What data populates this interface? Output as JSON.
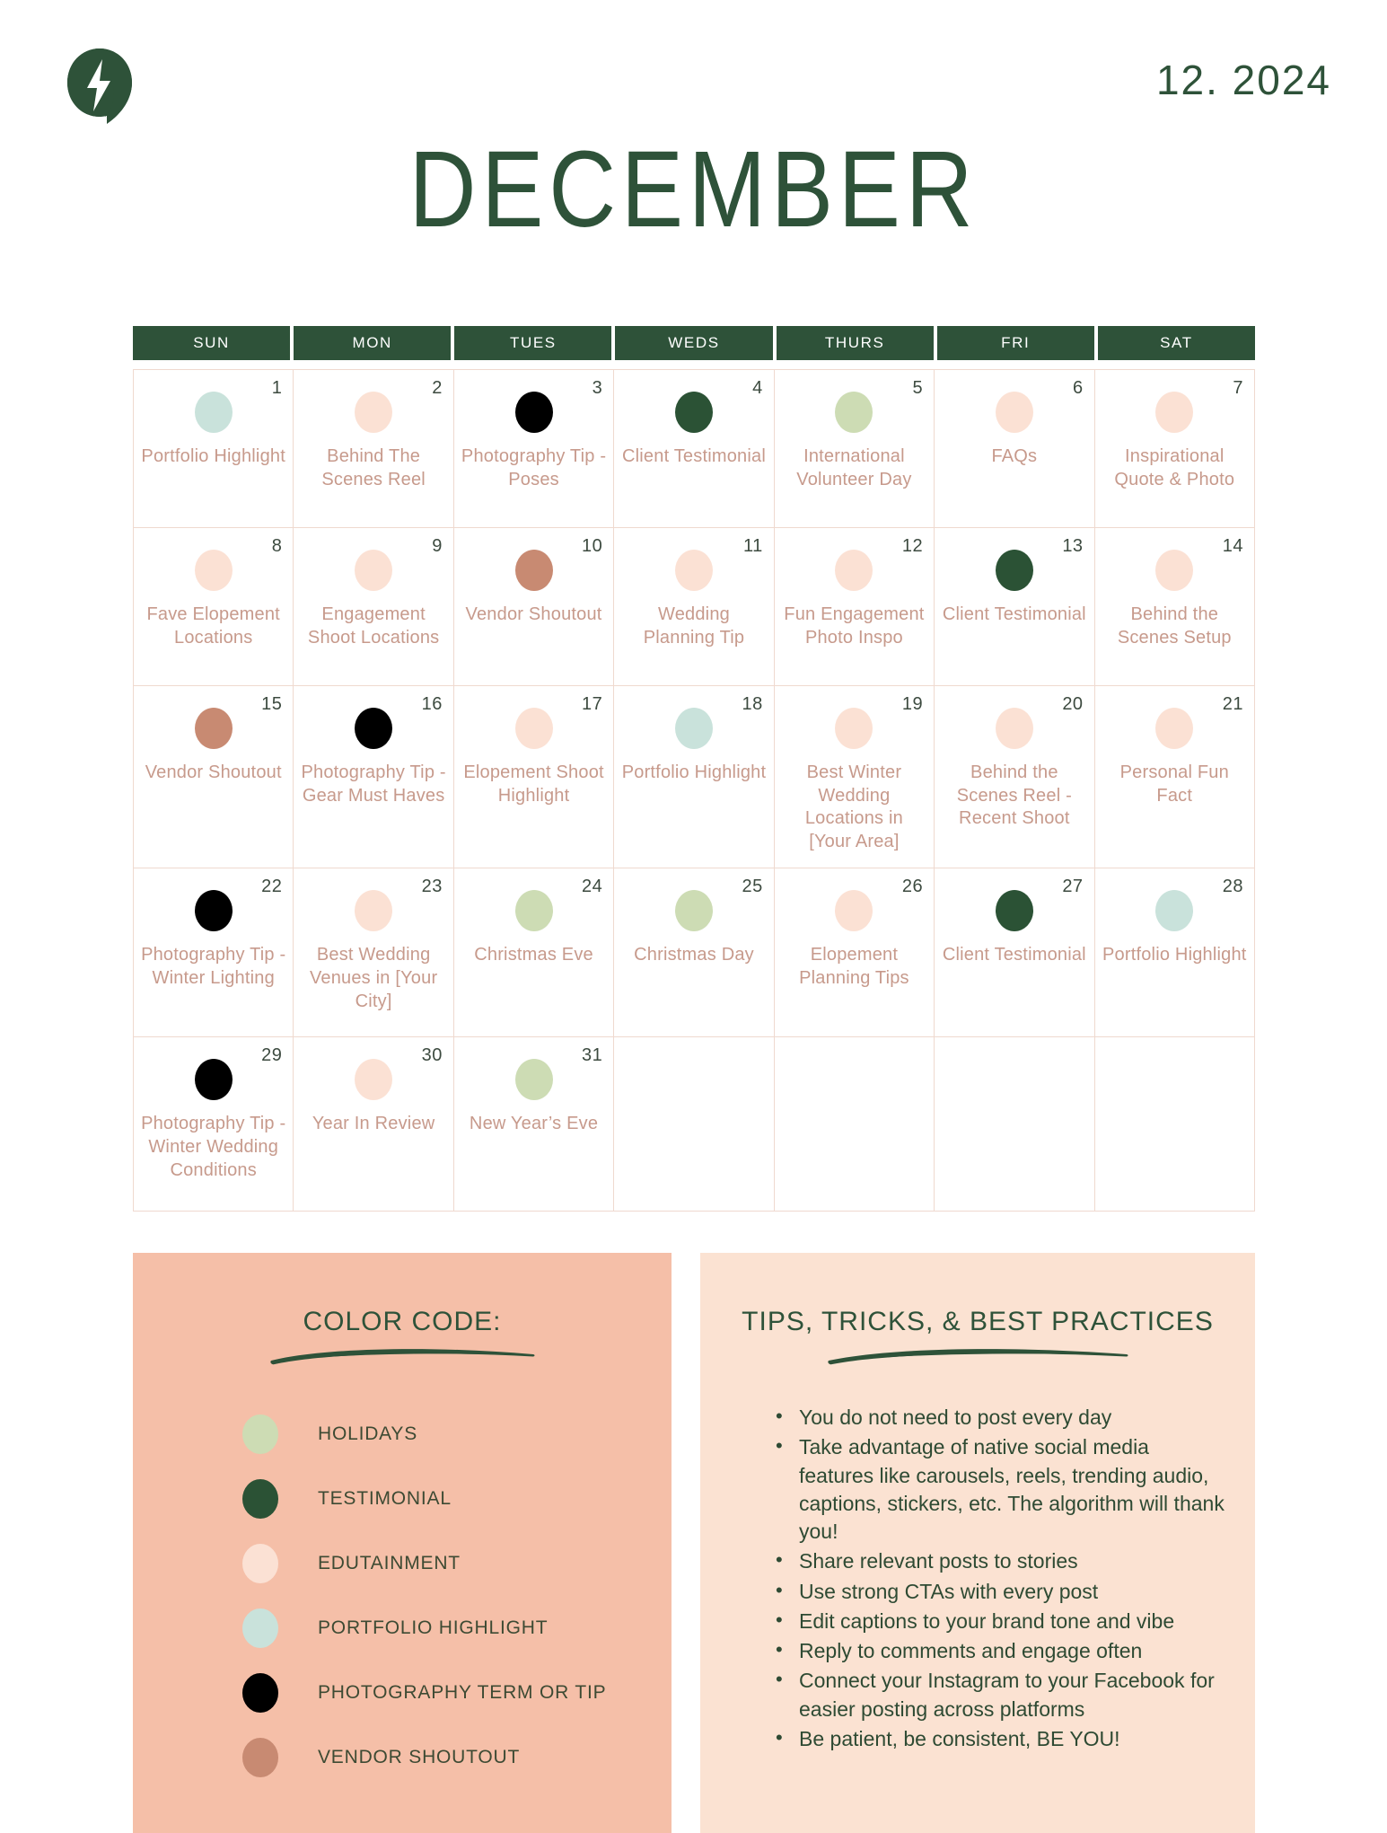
{
  "header": {
    "logo_icon": "leaf-bolt-logo",
    "date_code": "12. 2024",
    "month_title": "DECEMBER"
  },
  "calendar": {
    "weekday_headers": [
      "SUN",
      "MON",
      "TUES",
      "WEDS",
      "THURS",
      "FRI",
      "SAT"
    ],
    "colors": {
      "holidays": "#cddcb4",
      "testimonial": "#2b5235",
      "edutainment": "#fbe1d4",
      "portfolio_highlight": "#c9e2db",
      "photography_term_or_tip": "#000000",
      "vendor_shoutout": "#c88a72",
      "grid_line": "#efd9cf",
      "header_pill": "#2e5239",
      "day_text": "#c79a8c",
      "day_number": "#3c4a3f"
    },
    "weeks": [
      [
        {
          "num": "1",
          "text": "Portfolio Highlight",
          "dot": "portfolio_highlight"
        },
        {
          "num": "2",
          "text": "Behind The Scenes Reel",
          "dot": "edutainment"
        },
        {
          "num": "3",
          "text": "Photography Tip - Poses",
          "dot": "photography_term_or_tip"
        },
        {
          "num": "4",
          "text": "Client Testimonial",
          "dot": "testimonial"
        },
        {
          "num": "5",
          "text": "International Volunteer Day",
          "dot": "holidays"
        },
        {
          "num": "6",
          "text": "FAQs",
          "dot": "edutainment"
        },
        {
          "num": "7",
          "text": "Inspirational Quote & Photo",
          "dot": "edutainment"
        }
      ],
      [
        {
          "num": "8",
          "text": "Fave Elopement Locations",
          "dot": "edutainment"
        },
        {
          "num": "9",
          "text": "Engagement Shoot Locations",
          "dot": "edutainment"
        },
        {
          "num": "10",
          "text": "Vendor Shoutout",
          "dot": "vendor_shoutout"
        },
        {
          "num": "11",
          "text": "Wedding Planning Tip",
          "dot": "edutainment"
        },
        {
          "num": "12",
          "text": "Fun Engagement Photo Inspo",
          "dot": "edutainment"
        },
        {
          "num": "13",
          "text": "Client Testimonial",
          "dot": "testimonial"
        },
        {
          "num": "14",
          "text": "Behind the Scenes Setup",
          "dot": "edutainment"
        }
      ],
      [
        {
          "num": "15",
          "text": "Vendor Shoutout",
          "dot": "vendor_shoutout"
        },
        {
          "num": "16",
          "text": "Photography Tip - Gear Must Haves",
          "dot": "photography_term_or_tip"
        },
        {
          "num": "17",
          "text": "Elopement Shoot Highlight",
          "dot": "edutainment"
        },
        {
          "num": "18",
          "text": "Portfolio Highlight",
          "dot": "portfolio_highlight"
        },
        {
          "num": "19",
          "text": "Best Winter Wedding Locations in [Your Area]",
          "dot": "edutainment"
        },
        {
          "num": "20",
          "text": "Behind the Scenes Reel - Recent Shoot",
          "dot": "edutainment"
        },
        {
          "num": "21",
          "text": "Personal Fun Fact",
          "dot": "edutainment"
        }
      ],
      [
        {
          "num": "22",
          "text": "Photography Tip - Winter Lighting",
          "dot": "photography_term_or_tip"
        },
        {
          "num": "23",
          "text": "Best Wedding Venues in [Your City]",
          "dot": "edutainment"
        },
        {
          "num": "24",
          "text": "Christmas Eve",
          "dot": "holidays"
        },
        {
          "num": "25",
          "text": "Christmas Day",
          "dot": "holidays"
        },
        {
          "num": "26",
          "text": "Elopement Planning Tips",
          "dot": "edutainment"
        },
        {
          "num": "27",
          "text": "Client Testimonial",
          "dot": "testimonial"
        },
        {
          "num": "28",
          "text": "Portfolio Highlight",
          "dot": "portfolio_highlight"
        }
      ],
      [
        {
          "num": "29",
          "text": "Photography Tip - Winter Wedding Conditions",
          "dot": "photography_term_or_tip"
        },
        {
          "num": "30",
          "text": "Year In Review",
          "dot": "edutainment"
        },
        {
          "num": "31",
          "text": "New Year’s Eve",
          "dot": "holidays"
        },
        {
          "num": "",
          "text": "",
          "dot": ""
        },
        {
          "num": "",
          "text": "",
          "dot": ""
        },
        {
          "num": "",
          "text": "",
          "dot": ""
        },
        {
          "num": "",
          "text": "",
          "dot": ""
        }
      ]
    ]
  },
  "color_code_panel": {
    "title": "COLOR CODE:",
    "background": "#f5bfa8",
    "items": [
      {
        "label": "HOLIDAYS",
        "color": "#cddcb4"
      },
      {
        "label": "TESTIMONIAL",
        "color": "#2b5235"
      },
      {
        "label": "EDUTAINMENT",
        "color": "#fbe1d4"
      },
      {
        "label": "PORTFOLIO HIGHLIGHT",
        "color": "#c9e2db"
      },
      {
        "label": "PHOTOGRAPHY TERM OR TIP",
        "color": "#000000"
      },
      {
        "label": "VENDOR SHOUTOUT",
        "color": "#c88a72"
      }
    ]
  },
  "tips_panel": {
    "title": "TIPS, TRICKS, & BEST PRACTICES",
    "background": "#fbe2d2",
    "bullets": [
      "You do not need to post every day",
      "Take advantage of native social media features like carousels, reels, trending audio, captions, stickers, etc. The algorithm will thank you!",
      "Share relevant posts to stories",
      "Use strong CTAs with every post",
      "Edit captions to your brand tone and vibe",
      "Reply to comments and engage often",
      "Connect your Instagram to your Facebook for easier posting across platforms",
      "Be patient, be consistent, BE YOU!"
    ]
  }
}
